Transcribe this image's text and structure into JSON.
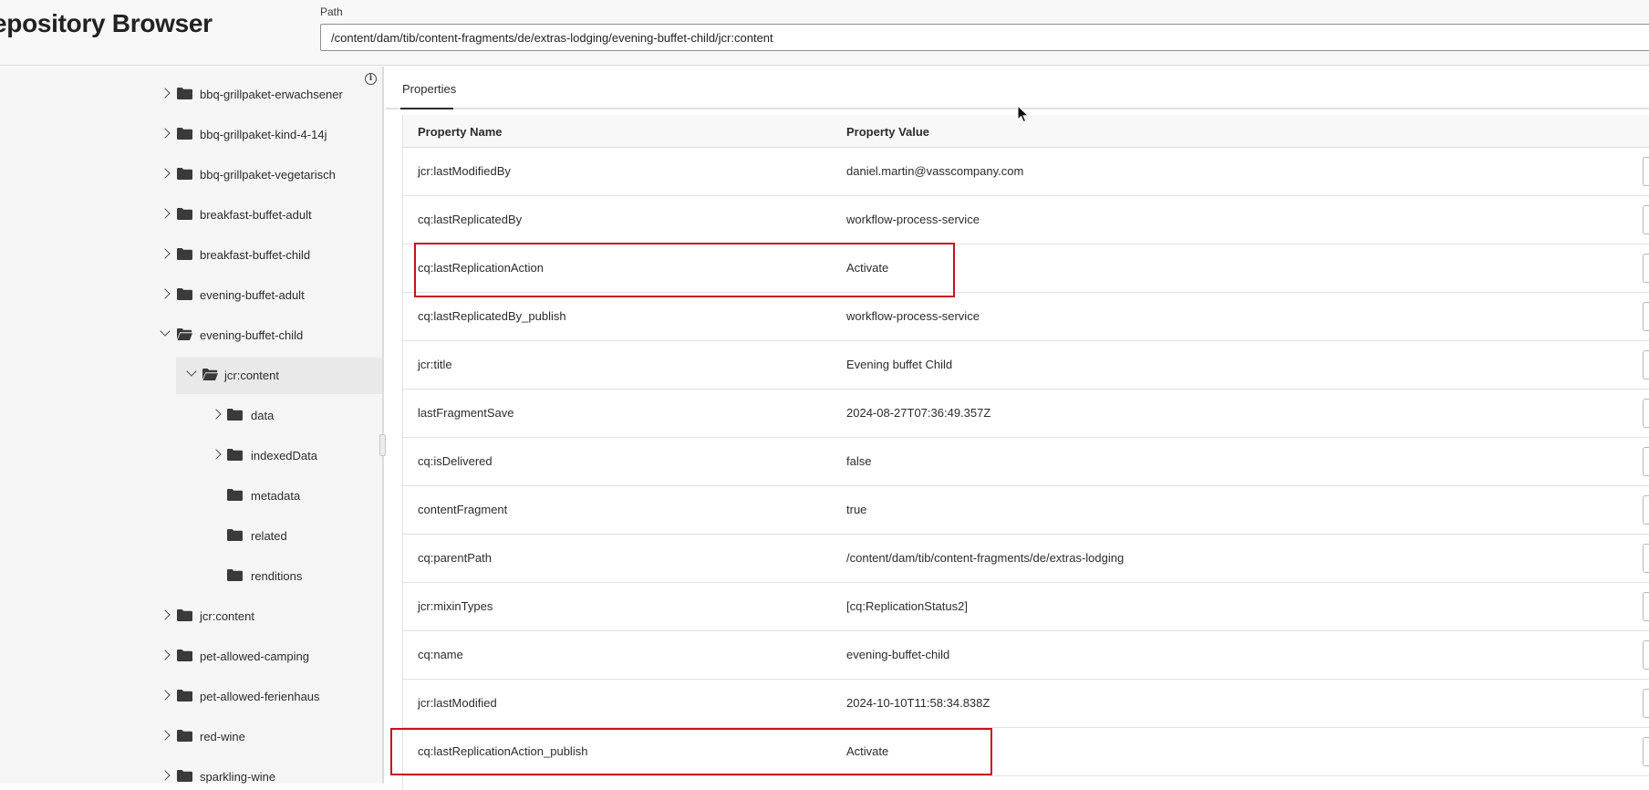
{
  "header": {
    "app_title": "epository Browser",
    "path_label": "Path",
    "path_value": "/content/dam/tib/content-fragments/de/extras-lodging/evening-buffet-child/jcr:content"
  },
  "sidebar": {
    "items": [
      {
        "label": "bbq-grillpaket-erwachsener",
        "expanded": false,
        "has_children": true
      },
      {
        "label": "bbq-grillpaket-kind-4-14j",
        "expanded": false,
        "has_children": true
      },
      {
        "label": "bbq-grillpaket-vegetarisch",
        "expanded": false,
        "has_children": true
      },
      {
        "label": "breakfast-buffet-adult",
        "expanded": false,
        "has_children": true
      },
      {
        "label": "breakfast-buffet-child",
        "expanded": false,
        "has_children": true
      },
      {
        "label": "evening-buffet-adult",
        "expanded": false,
        "has_children": true
      },
      {
        "label": "evening-buffet-child",
        "expanded": true,
        "has_children": true
      },
      {
        "label": "jcr:content",
        "expanded": true,
        "has_children": true,
        "selected": true
      },
      {
        "label": "data",
        "expanded": false,
        "has_children": true
      },
      {
        "label": "indexedData",
        "expanded": false,
        "has_children": true
      },
      {
        "label": "metadata",
        "expanded": false,
        "has_children": false
      },
      {
        "label": "related",
        "expanded": false,
        "has_children": false
      },
      {
        "label": "renditions",
        "expanded": false,
        "has_children": false
      },
      {
        "label": "jcr:content",
        "expanded": false,
        "has_children": true
      },
      {
        "label": "pet-allowed-camping",
        "expanded": false,
        "has_children": true
      },
      {
        "label": "pet-allowed-ferienhaus",
        "expanded": false,
        "has_children": true
      },
      {
        "label": "red-wine",
        "expanded": false,
        "has_children": true
      },
      {
        "label": "sparkling-wine",
        "expanded": false,
        "has_children": true
      }
    ]
  },
  "main": {
    "tab_label": "Properties",
    "columns": {
      "name": "Property Name",
      "value": "Property Value"
    },
    "rows": [
      {
        "name": "jcr:lastModifiedBy",
        "value": "daniel.martin@vasscompany.com"
      },
      {
        "name": "cq:lastReplicatedBy",
        "value": "workflow-process-service"
      },
      {
        "name": "cq:lastReplicationAction",
        "value": "Activate"
      },
      {
        "name": "cq:lastReplicatedBy_publish",
        "value": "workflow-process-service"
      },
      {
        "name": "jcr:title",
        "value": "Evening buffet Child"
      },
      {
        "name": "lastFragmentSave",
        "value": "2024-08-27T07:36:49.357Z"
      },
      {
        "name": "cq:isDelivered",
        "value": "false"
      },
      {
        "name": "contentFragment",
        "value": "true"
      },
      {
        "name": "cq:parentPath",
        "value": "/content/dam/tib/content-fragments/de/extras-lodging"
      },
      {
        "name": "jcr:mixinTypes",
        "value": "[cq:ReplicationStatus2]"
      },
      {
        "name": "cq:name",
        "value": "evening-buffet-child"
      },
      {
        "name": "jcr:lastModified",
        "value": "2024-10-10T11:58:34.838Z"
      },
      {
        "name": "cq:lastReplicationAction_publish",
        "value": "Activate"
      }
    ]
  },
  "colors": {
    "highlight": "#c8121e",
    "folder_icon": "#3a3a3a"
  },
  "icons": [
    "info-icon",
    "folder-icon",
    "folder-open-icon",
    "chevron-right-icon",
    "chevron-down-icon",
    "mouse-cursor-icon"
  ]
}
